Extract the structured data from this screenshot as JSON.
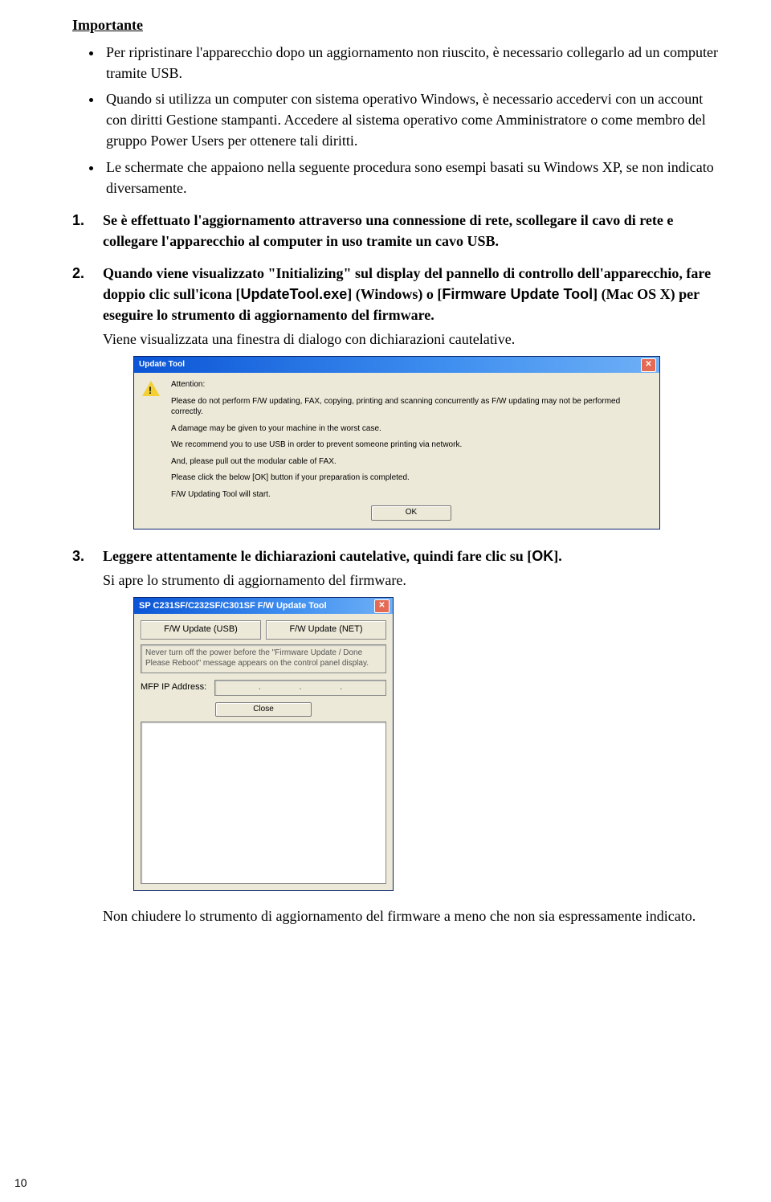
{
  "heading": "Importante",
  "bullets": [
    "Per ripristinare l'apparecchio dopo un aggiornamento non riuscito, è necessario collegarlo ad un computer tramite USB.",
    "Quando si utilizza un computer con sistema operativo Windows, è necessario accedervi con un account con diritti Gestione stampanti. Accedere al sistema operativo come Amministratore o come membro del gruppo Power Users per ottenere tali diritti.",
    "Le schermate che appaiono nella seguente procedura sono esempi basati su Windows XP, se non indicato diversamente."
  ],
  "steps": {
    "s1": "Se è effettuato l'aggiornamento attraverso una connessione di rete, scollegare il cavo di rete e collegare l'apparecchio al computer in uso tramite un cavo USB.",
    "s2_a": "Quando viene visualizzato \"Initializing\" sul display del pannello di controllo dell'apparecchio, fare doppio clic sull'icona [",
    "s2_b": "UpdateTool.exe",
    "s2_c": "] (Windows) o [",
    "s2_d": "Firmware Update Tool",
    "s2_e": "] (Mac OS X) per eseguire lo strumento di aggiornamento del firmware.",
    "s2_sub": "Viene visualizzata una finestra di dialogo con dichiarazioni cautelative.",
    "s3_a": "Leggere attentamente le dichiarazioni cautelative, quindi fare clic su [",
    "s3_b": "OK",
    "s3_c": "].",
    "s3_sub": "Si apre lo strumento di aggiornamento del firmware.",
    "closing": "Non chiudere lo strumento di aggiornamento del firmware a meno che non sia espressamente indicato."
  },
  "dlg1": {
    "title": "Update Tool",
    "attn": "Attention:",
    "l1": "Please do not perform F/W updating, FAX, copying, printing and scanning concurrently as F/W updating may not be performed correctly.",
    "l2": "A damage may be given to your machine in the worst case.",
    "l3": "We recommend you to use USB in order to prevent someone printing via network.",
    "l4": "And, please pull out the modular cable of FAX.",
    "l5": "Please click the below [OK] button if your preparation is completed.",
    "l6": "F/W Updating Tool will start.",
    "ok": "OK"
  },
  "dlg2": {
    "title": "SP C231SF/C232SF/C301SF F/W Update Tool",
    "tab_usb": "F/W Update (USB)",
    "tab_net": "F/W Update (NET)",
    "msg": "Never turn off the power before the \"Firmware Update / Done Please Reboot\" message appears on the control panel display.",
    "ip_label": "MFP IP Address:",
    "close": "Close"
  },
  "page_number": "10"
}
